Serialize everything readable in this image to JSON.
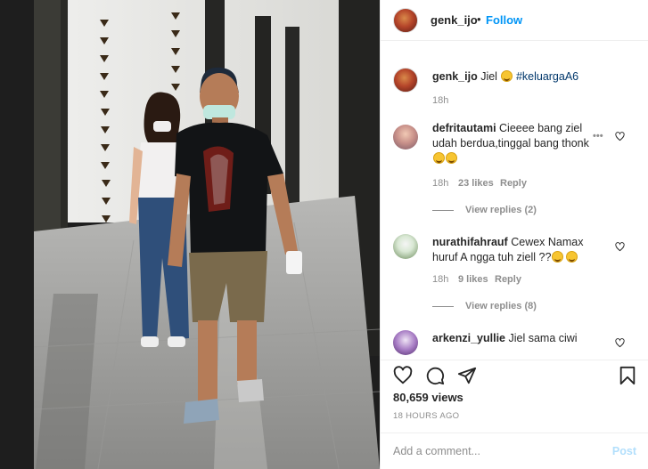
{
  "post": {
    "author": "genk_ijo",
    "follow_label": "Follow",
    "more_label": "•••",
    "caption": {
      "user": "genk_ijo",
      "text": "Jiel",
      "hashtag": "#keluargaA6",
      "time": "18h"
    }
  },
  "comments": [
    {
      "user": "defritautami",
      "line1": "Cieeee bang ziel",
      "line2": "udah berdua,tinggal bang thonk",
      "time": "18h",
      "likes": "23 likes",
      "reply": "Reply",
      "view_replies": "View replies (2)"
    },
    {
      "user": "nurathifahrauf",
      "line1": "Cewex Namax",
      "line2": "huruf A ngga tuh ziell ??",
      "time": "18h",
      "likes": "9 likes",
      "reply": "Reply",
      "view_replies": "View replies (8)"
    },
    {
      "user": "arkenzi_yullie",
      "line1": "Jiel sama ciwi"
    }
  ],
  "stats": {
    "views": "80,659 views",
    "timestamp": "18 HOURS AGO"
  },
  "add_comment": {
    "placeholder": "Add a comment...",
    "post_label": "Post"
  },
  "colors": {
    "accent": "#0095f6",
    "hashtag": "#00376b",
    "muted": "#8e8e8e",
    "post_disabled": "#b2dffc"
  },
  "icons": [
    "more-icon",
    "heart-icon",
    "comment-icon",
    "share-icon",
    "bookmark-icon",
    "emoji-icon"
  ]
}
